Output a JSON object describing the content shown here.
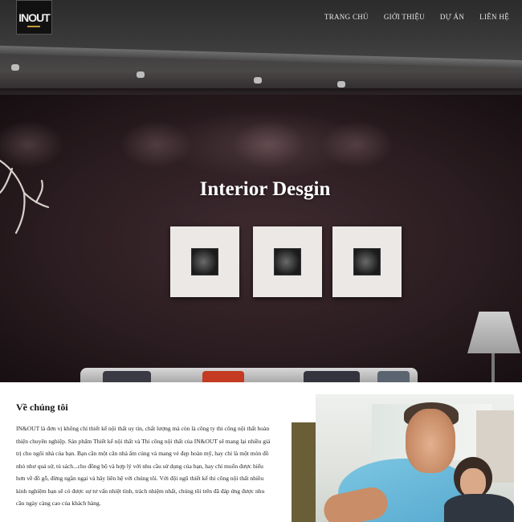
{
  "brand": {
    "logo_text": "INOUT"
  },
  "nav": {
    "items": [
      {
        "label": "TRANG CHỦ"
      },
      {
        "label": "GIỚI THIỆU"
      },
      {
        "label": "DỰ ÁN"
      },
      {
        "label": "LIÊN HỆ"
      }
    ]
  },
  "hero": {
    "title": "Interior Desgin"
  },
  "about": {
    "heading": "Về chúng tôi",
    "body": "IN&OUT là đơn vị không chỉ thiết kế nội thất uy tín, chất lượng mà còn là công ty thi công nội thất hoàn thiện chuyên nghiệp. Sản phẩm Thiết kế nội thất và Thi công nội thất của IN&OUT sẽ mang lại nhiều giá trị cho ngôi nhà của bạn. Bạn cần một căn nhà ấm cúng và mang vẻ đẹp hoàn mỹ, hay chỉ là một món đồ nhỏ như quả sứ, tủ sách...cho đồng bộ và hợp lý với nhu cầu sử dụng của bạn, hay chỉ muốn được hiểu hơn về đồ gỗ, đừng ngần ngại và hãy liên hệ với chúng tôi. Với đội ngũ thiết kế thi công nội thất nhiều kinh nghiệm bạn sẽ có được sự tư vấn nhiệt tình, trách nhiệm nhất, chúng tôi trên đã đáp ứng được nhu cầu ngày càng cao của khách hàng."
  },
  "colors": {
    "accent_olive": "#6a5e37",
    "logo_accent": "#c49a3a"
  },
  "icons": {
    "logo": "inout-logo"
  }
}
